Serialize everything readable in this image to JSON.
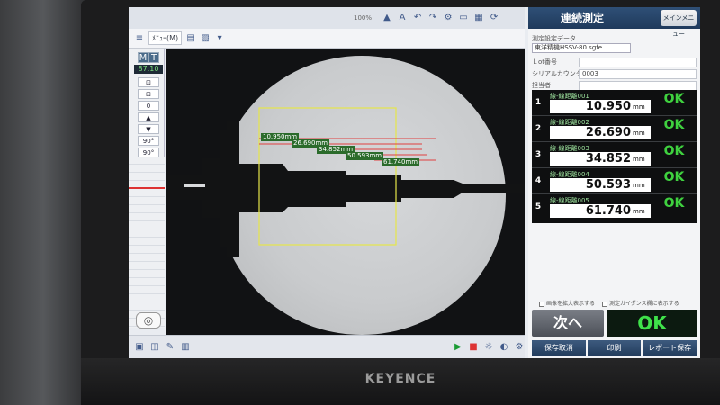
{
  "brand": "KEYENCE",
  "toolbar": {
    "menu_label": "ﾒﾆｭｰ(M)",
    "zoom_label": "100%"
  },
  "sidepanel": {
    "mode_m": "M",
    "mode_t": "T",
    "magnification": "87.10",
    "value_zero": "0",
    "angle_1": "90°",
    "angle_2": "90°"
  },
  "measurements_overlay": [
    {
      "label": "10.950mm"
    },
    {
      "label": "26.690mm"
    },
    {
      "label": "34.852mm"
    },
    {
      "label": "50.593mm"
    },
    {
      "label": "61.740mm"
    }
  ],
  "right_panel": {
    "title": "連続測定",
    "menu_button": "メインメニュー",
    "data_label": "測定設定データ",
    "data_file": "東洋精機HSSV-80.sgfe",
    "info": [
      {
        "label": "Ｌot番号",
        "value": ""
      },
      {
        "label": "シリアルカウンタ",
        "value": "0003"
      },
      {
        "label": "担当者",
        "value": ""
      }
    ],
    "results": [
      {
        "num": "1",
        "name": "線-線距離001",
        "value": "10.950",
        "unit": "mm",
        "status": "OK"
      },
      {
        "num": "2",
        "name": "線-線距離002",
        "value": "26.690",
        "unit": "mm",
        "status": "OK"
      },
      {
        "num": "3",
        "name": "線-線距離003",
        "value": "34.852",
        "unit": "mm",
        "status": "OK"
      },
      {
        "num": "4",
        "name": "線-線距離004",
        "value": "50.593",
        "unit": "mm",
        "status": "OK"
      },
      {
        "num": "5",
        "name": "線-線距離005",
        "value": "61.740",
        "unit": "mm",
        "status": "OK"
      }
    ],
    "check_1": "画像を拡大表示する",
    "check_2": "測定ガイダンス欄に表示する",
    "next_label": "次へ",
    "overall_status": "OK",
    "footer": [
      "保存取消",
      "印刷",
      "レポート保存"
    ]
  },
  "colors": {
    "ok_green": "#3fd13f",
    "header_blue": "#2f4f76",
    "overlay_yellow": "#e6e64a",
    "overlay_red": "#e04040"
  }
}
